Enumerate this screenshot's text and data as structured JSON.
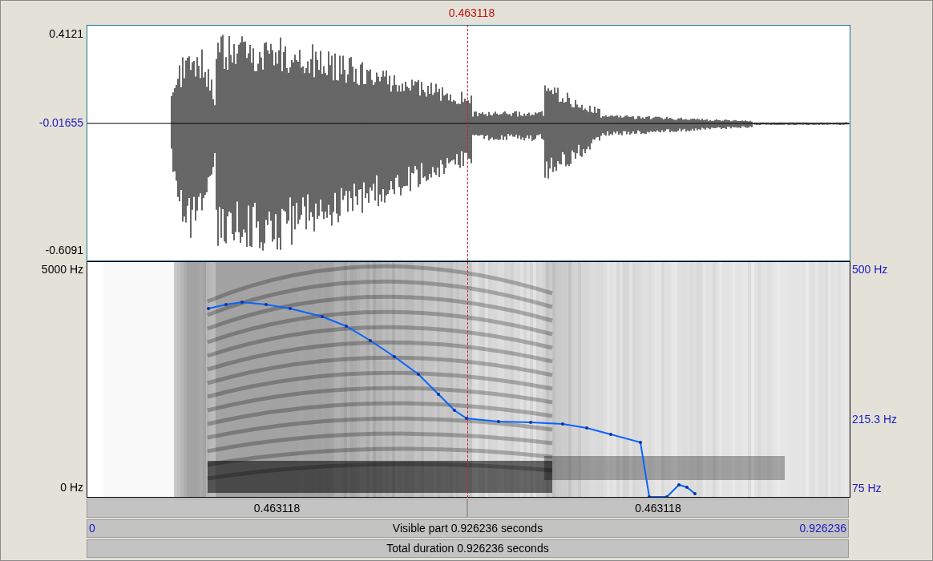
{
  "cursor": {
    "time": "0.463118"
  },
  "waveform": {
    "y_max": "0.4121",
    "y_zero": "-0.01655",
    "y_min": "-0.6091"
  },
  "spectrogram": {
    "freq_max": "5000 Hz",
    "freq_min": "0 Hz",
    "pitch_max": "500 Hz",
    "pitch_mid": "215.3 Hz",
    "pitch_min": "75 Hz"
  },
  "selection_bar": [
    "0.463118",
    "0.463118"
  ],
  "visible_bar": {
    "start": "0",
    "label": "Visible part 0.926236 seconds",
    "end": "0.926236"
  },
  "total_bar": {
    "label": "Total duration 0.926236 seconds"
  }
}
